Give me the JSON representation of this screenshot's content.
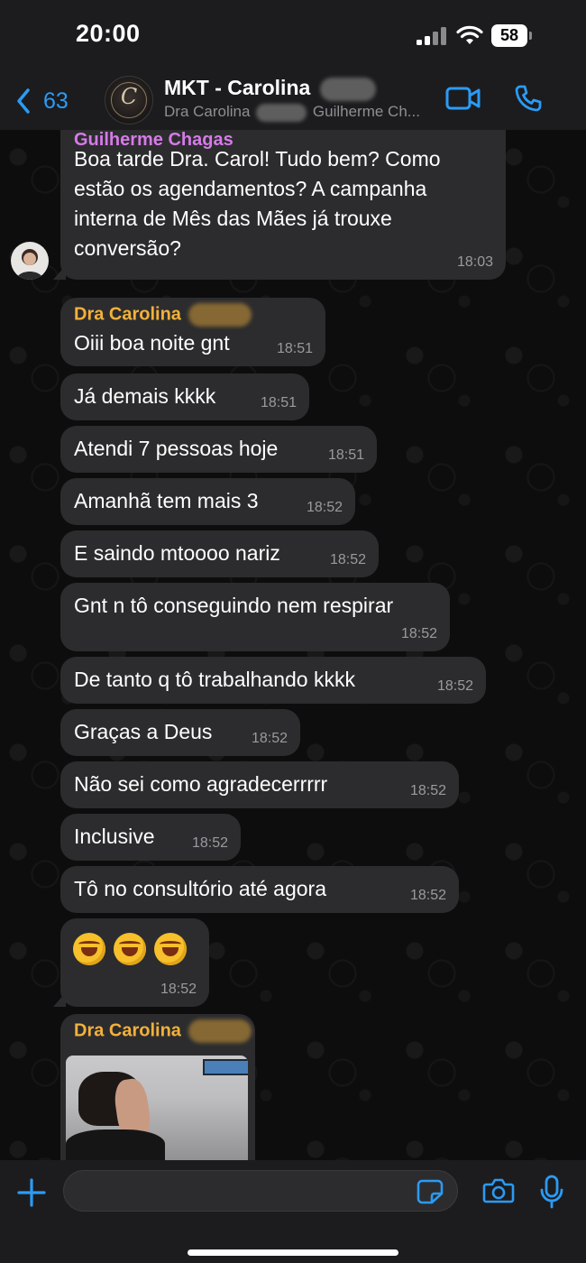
{
  "status_bar": {
    "time": "20:00",
    "battery": "58"
  },
  "header": {
    "back_count": "63",
    "title": "MKT - Carolina",
    "subtitle_part1": "Dra Carolina",
    "subtitle_part2": "Guilherme Ch...",
    "avatar_monogram": "C"
  },
  "colors": {
    "accent": "#2b9bf4",
    "sender_guilherme": "#d67ae8",
    "sender_carolina": "#f2b13a",
    "bubble": "#2c2c2e",
    "timestamp": "#9a9a9f"
  },
  "messages": [
    {
      "sender": "Guilherme Chagas",
      "text": "Boa tarde Dra. Carol! Tudo bem? Como estão os agendamentos? A campanha interna de Mês das Mães já trouxe conversão?",
      "time": "18:03"
    },
    {
      "sender": "Dra Carolina",
      "text": "Oiii boa noite gnt",
      "time": "18:51"
    },
    {
      "text": "Já demais kkkk",
      "time": "18:51"
    },
    {
      "text": "Atendi 7 pessoas hoje",
      "time": "18:51"
    },
    {
      "text": "Amanhã tem mais 3",
      "time": "18:52"
    },
    {
      "text": "E saindo mtoooo nariz",
      "time": "18:52"
    },
    {
      "text": "Gnt n tô conseguindo nem respirar",
      "time": "18:52"
    },
    {
      "text": "De tanto q tô trabalhando kkkk",
      "time": "18:52"
    },
    {
      "text": "Graças a Deus",
      "time": "18:52"
    },
    {
      "text": "Não sei como agradecerrrrr",
      "time": "18:52"
    },
    {
      "text": "Inclusive",
      "time": "18:52"
    },
    {
      "text": "Tô no consultório até agora",
      "time": "18:52"
    },
    {
      "emoji": "rolling-on-floor-laughing x3",
      "time": "18:52"
    },
    {
      "sender": "Dra Carolina",
      "media": "photo"
    }
  ],
  "composer": {
    "placeholder": ""
  }
}
